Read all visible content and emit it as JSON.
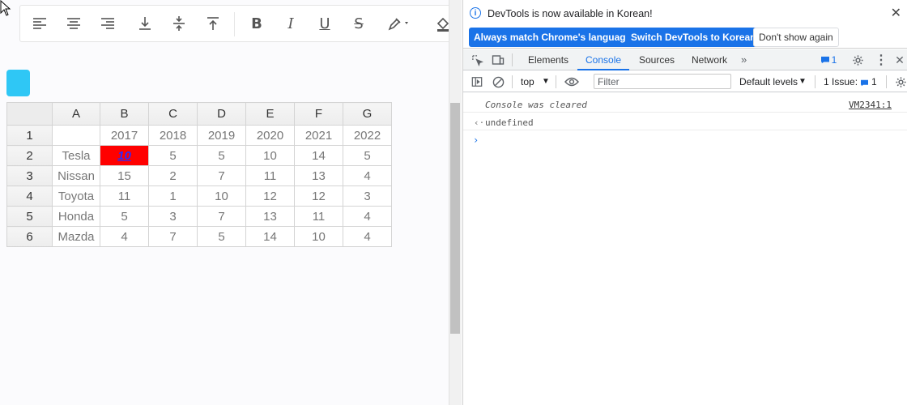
{
  "toolbar": {
    "buttons": [
      "align-left-icon",
      "align-center-icon",
      "align-right-icon",
      "align-bottom-icon",
      "align-middle-icon",
      "align-top-icon"
    ],
    "bold": "B",
    "italic": "I",
    "underline": "U",
    "strike": "S"
  },
  "grid": {
    "columns": [
      "A",
      "B",
      "C",
      "D",
      "E",
      "F",
      "G"
    ],
    "rows": [
      {
        "num": "1",
        "cells": [
          "",
          "2017",
          "2018",
          "2019",
          "2020",
          "2021",
          "2022"
        ]
      },
      {
        "num": "2",
        "cells": [
          "Tesla",
          "10",
          "5",
          "5",
          "10",
          "14",
          "5"
        ]
      },
      {
        "num": "3",
        "cells": [
          "Nissan",
          "15",
          "2",
          "7",
          "11",
          "13",
          "4"
        ]
      },
      {
        "num": "4",
        "cells": [
          "Toyota",
          "11",
          "1",
          "10",
          "12",
          "12",
          "3"
        ]
      },
      {
        "num": "5",
        "cells": [
          "Honda",
          "5",
          "3",
          "7",
          "13",
          "11",
          "4"
        ]
      },
      {
        "num": "6",
        "cells": [
          "Mazda",
          "4",
          "7",
          "5",
          "14",
          "10",
          "4"
        ]
      }
    ],
    "selected_cell_color": "#ff0000",
    "selected_text_color": "#2a2aff"
  },
  "devtools": {
    "info_message": "DevTools is now available in Korean!",
    "btn_match": "Always match Chrome's language",
    "btn_switch": "Switch DevTools to Korean",
    "btn_dont_show": "Don't show again",
    "tabs": [
      "Elements",
      "Console",
      "Sources",
      "Network"
    ],
    "active_tab": "Console",
    "issues_badge": "1",
    "context": "top",
    "filter_placeholder": "Filter",
    "levels": "Default levels",
    "issues_label": "1 Issue:",
    "issues_count": "1",
    "console": {
      "cleared": "Console was cleared",
      "cleared_source": "VM2341:1",
      "result": "undefined"
    },
    "accent": "#1a73e8"
  }
}
